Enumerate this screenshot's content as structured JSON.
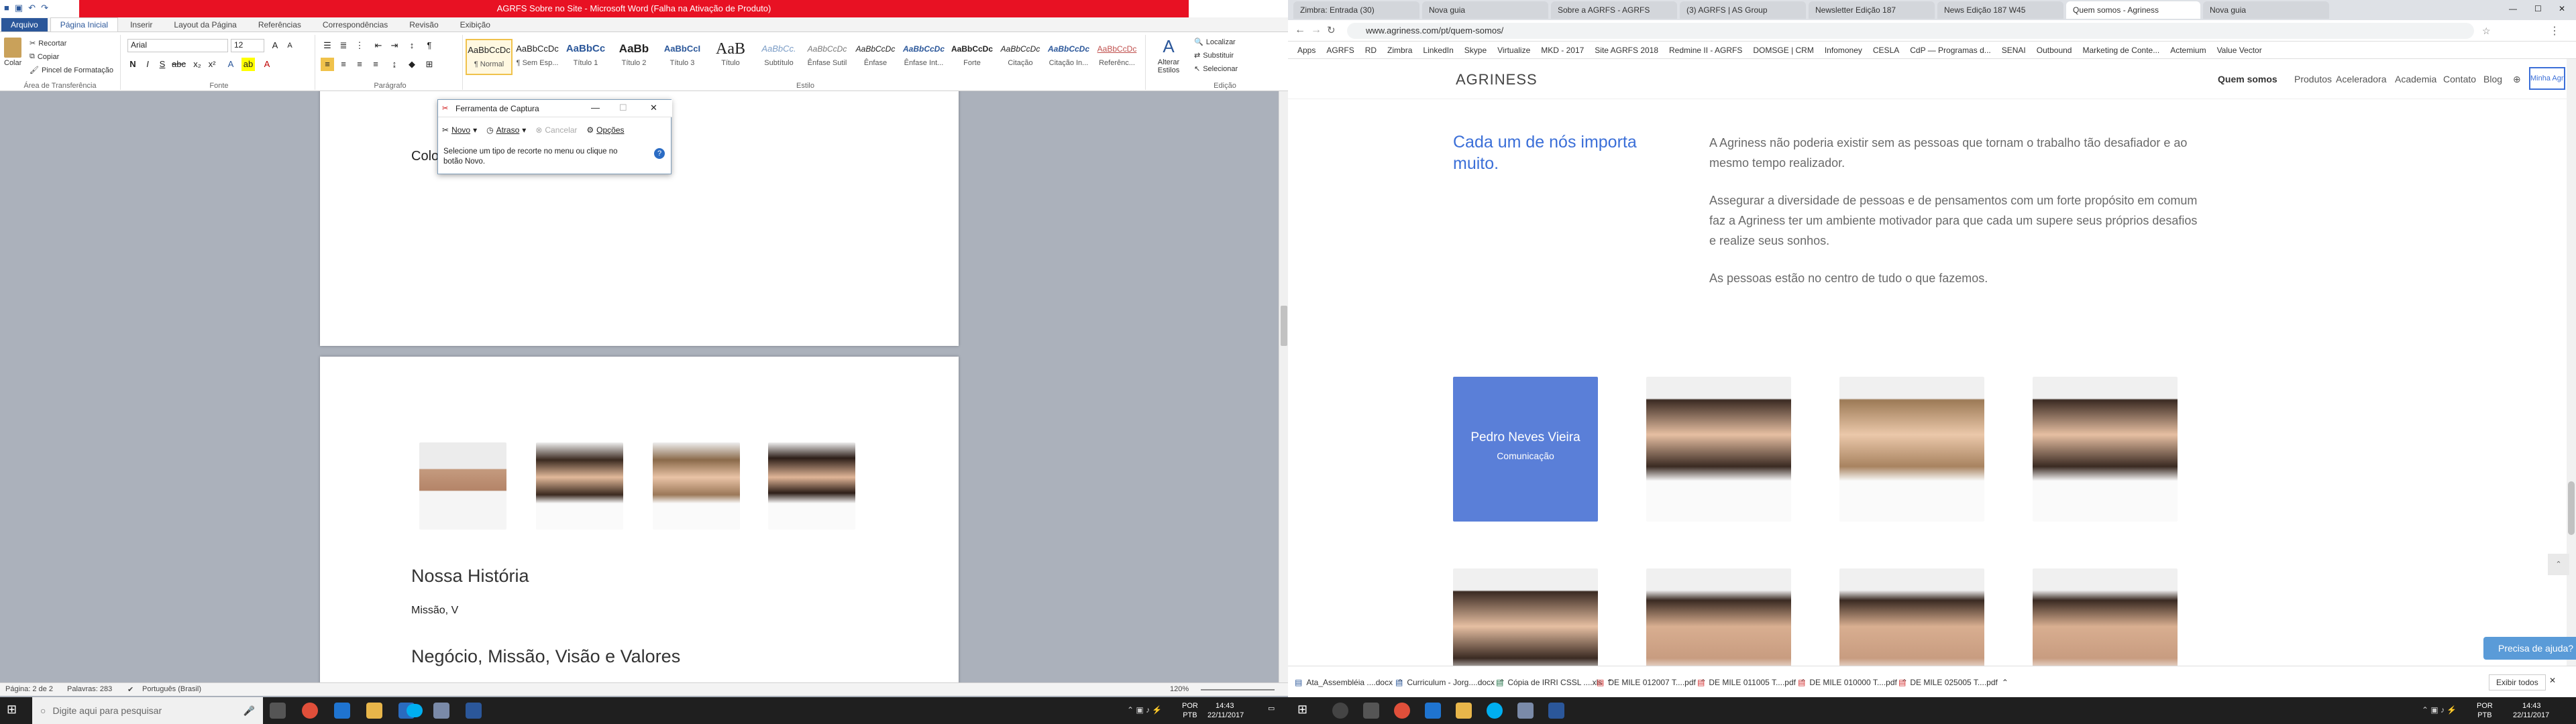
{
  "word": {
    "title": "AGRFS Sobre no Site - Microsoft Word (Falha na Ativação de Produto)",
    "tabs": [
      "Arquivo",
      "Página Inicial",
      "Inserir",
      "Layout da Página",
      "Referências",
      "Correspondências",
      "Revisão",
      "Exibição"
    ],
    "clipboard": {
      "paste": "Colar",
      "cut": "Recortar",
      "copy": "Copiar",
      "format_painter": "Pincel de Formatação",
      "group": "Área de Transferência"
    },
    "font": {
      "name": "Arial",
      "size": "12",
      "group": "Fonte"
    },
    "paragraph_group": "Parágrafo",
    "styles": [
      {
        "preview": "AaBbCcDc",
        "name": "¶ Normal"
      },
      {
        "preview": "AaBbCcDc",
        "name": "¶ Sem Esp..."
      },
      {
        "preview": "AaBbCc",
        "name": "Título 1"
      },
      {
        "preview": "AaBb",
        "name": "Título 2"
      },
      {
        "preview": "AaBbCcI",
        "name": "Título 3"
      },
      {
        "preview": "AaB",
        "name": "Título"
      },
      {
        "preview": "AaBbCc.",
        "name": "Subtítulo"
      },
      {
        "preview": "AaBbCcDc",
        "name": "Ênfase Sutil"
      },
      {
        "preview": "AaBbCcDc",
        "name": "Ênfase"
      },
      {
        "preview": "AaBbCcDc",
        "name": "Ênfase Int..."
      },
      {
        "preview": "AaBbCcDc",
        "name": "Forte"
      },
      {
        "preview": "AaBbCcDc",
        "name": "Citação"
      },
      {
        "preview": "AaBbCcDc",
        "name": "Citação In..."
      },
      {
        "preview": "AaBbCcDc",
        "name": "Referênc..."
      }
    ],
    "styles_group": "Estilo",
    "change_styles": "Alterar Estilos",
    "editing": {
      "find": "Localizar",
      "replace": "Substituir",
      "select": "Selecionar",
      "group": "Edição"
    },
    "doc": {
      "partial_text": "Colo",
      "heading1": "Nossa História",
      "line1": "Missão, V",
      "heading2": "Negócio, Missão, Visão e Valores"
    },
    "status": {
      "page": "Página: 2 de 2",
      "words": "Palavras: 283",
      "lang": "Português (Brasil)",
      "zoom": "120%"
    },
    "snip": {
      "title": "Ferramenta de Captura",
      "new": "Novo",
      "delay": "Atraso",
      "cancel": "Cancelar",
      "options": "Opções",
      "hint": "Selecione um tipo de recorte no menu ou clique no botão Novo."
    },
    "taskbar": {
      "search": "Digite aqui para pesquisar",
      "lang": "POR\nPTB",
      "time": "14:43",
      "date": "22/11/2017"
    }
  },
  "chrome": {
    "tabs": [
      "Zimbra: Entrada (30)",
      "Nova guia",
      "Sobre a AGRFS - AGRFS",
      "(3) AGRFS | AS Group",
      "Newsletter Edição 187",
      "News Edição 187 W45",
      "Quem somos - Agriness",
      "Nova guia"
    ],
    "active_tab": 6,
    "url": "www.agriness.com/pt/quem-somos/",
    "bookmarks": [
      "Apps",
      "AGRFS",
      "RD",
      "Zimbra",
      "LinkedIn",
      "Skype",
      "Virtualize",
      "MKD - 2017",
      "Site AGRFS 2018",
      "Redmine II - AGRFS",
      "DOMSGE | CRM",
      "Infomoney",
      "CESLA",
      "CdP — Programas d...",
      "SENAI",
      "Outbound",
      "Marketing de Conte...",
      "Actemium",
      "Value Vector"
    ],
    "site": {
      "logo": "AGRINESS",
      "nav": [
        "Quem somos",
        "Produtos",
        "Aceleradora",
        "Academia",
        "Contato",
        "Blog"
      ],
      "nav_button": "Minha Agriness",
      "accent": "#3b6fd8",
      "headline": "Cada um de nós importa muito.",
      "p1": "A Agriness não poderia existir sem as pessoas que tornam o trabalho tão desafiador e ao mesmo tempo realizador.",
      "p2": "Assegurar a diversidade de pessoas e de pensamentos com um forte propósito em comum faz a Agriness ter um ambiente motivador para que cada um supere seus próprios desafios e realize seus sonhos.",
      "p3": "As pessoas estão no centro de tudo o que fazemos.",
      "member_name": "Pedro Neves Vieira",
      "member_role": "Comunicação",
      "help": "Precisa de ajuda?"
    },
    "downloads": [
      "Ata_Assembléia ....docx",
      "Curriculum - Jorg....docx",
      "Cópia de IRRI CSSL ....xls",
      "DE MILE 012007 T....pdf",
      "DE MILE 011005 T....pdf",
      "DE MILE 010000 T....pdf",
      "DE MILE 025005 T....pdf"
    ],
    "show_all": "Exibir todos",
    "taskbar": {
      "lang": "POR\nPTB",
      "time": "14:43",
      "date": "22/11/2017"
    }
  }
}
